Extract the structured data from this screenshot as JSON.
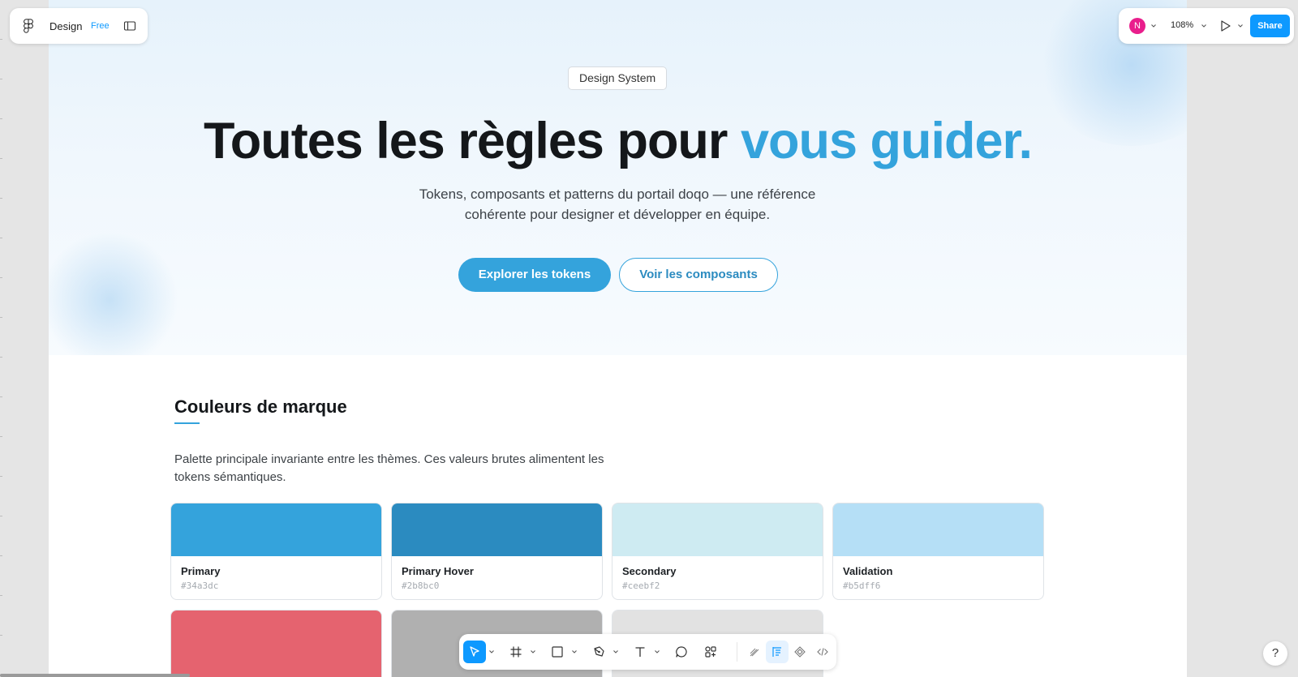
{
  "app": {
    "file_name": "Design",
    "plan": "Free",
    "avatar_initial": "N",
    "zoom": "108%",
    "share_label": "Share",
    "help_label": "?"
  },
  "hero": {
    "tag": "Design System",
    "headline_main": "Toutes les règles pour ",
    "headline_accent": "vous guider.",
    "subtitle_line1": "Tokens, composants et patterns du portail doqo — une référence",
    "subtitle_line2": "cohérente pour designer et développer en équipe.",
    "primary_cta": "Explorer les tokens",
    "secondary_cta": "Voir les composants"
  },
  "brand_colors": {
    "title": "Couleurs de marque",
    "description_line1": "Palette principale invariante entre les thèmes. Ces valeurs brutes alimentent les",
    "description_line2": "tokens sémantiques.",
    "swatches": [
      {
        "name": "Primary",
        "hex": "#34a3dc",
        "color": "#34a3dc"
      },
      {
        "name": "Primary Hover",
        "hex": "#2b8bc0",
        "color": "#2b8bc0"
      },
      {
        "name": "Secondary",
        "hex": "#ceebf2",
        "color": "#ceebf2"
      },
      {
        "name": "Validation",
        "hex": "#b5dff6",
        "color": "#b5dff6"
      }
    ],
    "partial_swatches": [
      {
        "color": "#e5636f"
      },
      {
        "color": "#b0b0b0"
      },
      {
        "color": "#e2e2e2"
      }
    ]
  },
  "toolbar": {
    "tools": [
      "move-tool",
      "frame-tool",
      "rectangle-tool",
      "pen-tool",
      "text-tool",
      "comment-tool",
      "actions-tool"
    ],
    "modes": [
      "draw-mode",
      "design-mode",
      "dev-mode-components",
      "code-mode"
    ],
    "active_tool": "move-tool",
    "active_mode": "design-mode"
  },
  "colors": {
    "accent": "#34a3dc",
    "accent_hover": "#2b8bc0",
    "figma_blue": "#0d99ff",
    "headline": "#14171a"
  }
}
